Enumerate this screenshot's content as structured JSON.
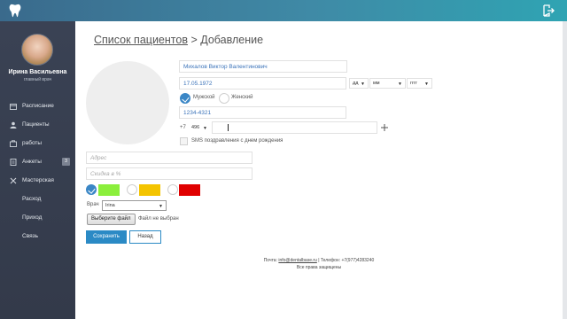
{
  "header": {
    "logo_icon": "tooth-icon",
    "exit_icon": "logout-icon"
  },
  "user": {
    "name": "Ирина Васильевна",
    "role": "главный врач"
  },
  "sidebar": {
    "items": [
      {
        "label": "Расписание",
        "icon": "calendar-icon"
      },
      {
        "label": "Пациенты",
        "icon": "patients-icon"
      },
      {
        "label": "работы",
        "icon": "folder-icon"
      },
      {
        "label": "Анкеты",
        "icon": "document-icon",
        "badge": "3"
      },
      {
        "label": "Мастерская",
        "icon": "tools-icon"
      },
      {
        "label": "Расход"
      },
      {
        "label": "Приход"
      },
      {
        "label": "Связь"
      }
    ]
  },
  "breadcrumb": {
    "parent": "Список пациентов",
    "separator": ">",
    "current": "Добавление"
  },
  "form": {
    "full_name": "Михалов Виктор Валентинович",
    "birth_date": "17.05.1972",
    "day_select": "дд",
    "month_select": "мм",
    "year_select": "гггг",
    "gender_male": "Мужской",
    "gender_female": "Женский",
    "gender_selected": "male",
    "card_number": "1234-4321",
    "phone_prefix": "+7",
    "phone_code": "496",
    "phone_number": "",
    "sms_label": "SMS поздравления с днем рождения",
    "address_placeholder": "Адрес",
    "discount_placeholder": "Скидка в %",
    "colors": [
      {
        "color": "#8bef3c",
        "checked": true
      },
      {
        "color": "#f4c400",
        "checked": false
      },
      {
        "color": "#e00000",
        "checked": false
      }
    ],
    "doctor_label": "Врач",
    "doctor_value": "Irina",
    "file_button": "Выберите файл",
    "file_status": "Файл не выбран",
    "save_button": "Сохранить",
    "back_button": "Назад"
  },
  "footer": {
    "email_label": "Почта:",
    "email": "info@dentalbase.ru",
    "phone_label": "Телефон:",
    "phone": "+7(977)4283240",
    "rights": "Все права защищены"
  }
}
